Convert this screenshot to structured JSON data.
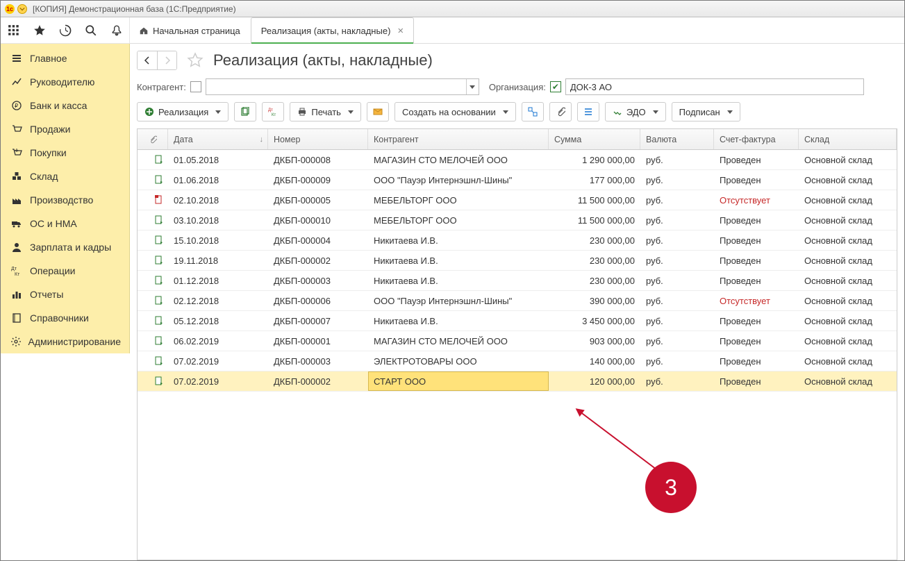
{
  "window_title": "[КОПИЯ] Демонстрационная база  (1С:Предприятие)",
  "tabs": {
    "home": "Начальная страница",
    "active": "Реализация (акты, накладные)"
  },
  "page_title": "Реализация (акты, накладные)",
  "filters": {
    "contr_label": "Контрагент:",
    "org_label": "Организация:",
    "org_value": "ДОК-3 АО"
  },
  "toolbar": {
    "realize": "Реализация",
    "print": "Печать",
    "create_based": "Создать на основании",
    "edo": "ЭДО",
    "signed": "Подписан"
  },
  "columns": {
    "date": "Дата",
    "number": "Номер",
    "contr": "Контрагент",
    "sum": "Сумма",
    "cur": "Валюта",
    "invoice": "Счет-фактура",
    "wh": "Склад"
  },
  "rows": [
    {
      "date": "01.05.2018",
      "num": "ДКБП-000008",
      "contr": "МАГАЗИН СТО МЕЛОЧЕЙ ООО",
      "sum": "1 290 000,00",
      "cur": "руб.",
      "inv": "Проведен",
      "wh": "Основной склад",
      "inv_red": false,
      "icon_red": false
    },
    {
      "date": "01.06.2018",
      "num": "ДКБП-000009",
      "contr": "ООО \"Пауэр Интернэшнл-Шины\"",
      "sum": "177 000,00",
      "cur": "руб.",
      "inv": "Проведен",
      "wh": "Основной склад",
      "inv_red": false,
      "icon_red": false
    },
    {
      "date": "02.10.2018",
      "num": "ДКБП-000005",
      "contr": "МЕБЕЛЬТОРГ ООО",
      "sum": "11 500 000,00",
      "cur": "руб.",
      "inv": "Отсутствует",
      "wh": "Основной склад",
      "inv_red": true,
      "icon_red": true
    },
    {
      "date": "03.10.2018",
      "num": "ДКБП-000010",
      "contr": "МЕБЕЛЬТОРГ ООО",
      "sum": "11 500 000,00",
      "cur": "руб.",
      "inv": "Проведен",
      "wh": "Основной склад",
      "inv_red": false,
      "icon_red": false
    },
    {
      "date": "15.10.2018",
      "num": "ДКБП-000004",
      "contr": "Никитаева И.В.",
      "sum": "230 000,00",
      "cur": "руб.",
      "inv": "Проведен",
      "wh": "Основной склад",
      "inv_red": false,
      "icon_red": false
    },
    {
      "date": "19.11.2018",
      "num": "ДКБП-000002",
      "contr": "Никитаева И.В.",
      "sum": "230 000,00",
      "cur": "руб.",
      "inv": "Проведен",
      "wh": "Основной склад",
      "inv_red": false,
      "icon_red": false
    },
    {
      "date": "01.12.2018",
      "num": "ДКБП-000003",
      "contr": "Никитаева И.В.",
      "sum": "230 000,00",
      "cur": "руб.",
      "inv": "Проведен",
      "wh": "Основной склад",
      "inv_red": false,
      "icon_red": false
    },
    {
      "date": "02.12.2018",
      "num": "ДКБП-000006",
      "contr": "ООО \"Пауэр Интернэшнл-Шины\"",
      "sum": "390 000,00",
      "cur": "руб.",
      "inv": "Отсутствует",
      "wh": "Основной склад",
      "inv_red": true,
      "icon_red": false
    },
    {
      "date": "05.12.2018",
      "num": "ДКБП-000007",
      "contr": "Никитаева И.В.",
      "sum": "3 450 000,00",
      "cur": "руб.",
      "inv": "Проведен",
      "wh": "Основной склад",
      "inv_red": false,
      "icon_red": false
    },
    {
      "date": "06.02.2019",
      "num": "ДКБП-000001",
      "contr": "МАГАЗИН СТО МЕЛОЧЕЙ ООО",
      "sum": "903 000,00",
      "cur": "руб.",
      "inv": "Проведен",
      "wh": "Основной склад",
      "inv_red": false,
      "icon_red": false
    },
    {
      "date": "07.02.2019",
      "num": "ДКБП-000003",
      "contr": "ЭЛЕКТРОТОВАРЫ ООО",
      "sum": "140 000,00",
      "cur": "руб.",
      "inv": "Проведен",
      "wh": "Основной склад",
      "inv_red": false,
      "icon_red": false
    },
    {
      "date": "07.02.2019",
      "num": "ДКБП-000002",
      "contr": "СТАРТ ООО",
      "sum": "120 000,00",
      "cur": "руб.",
      "inv": "Проведен",
      "wh": "Основной склад",
      "inv_red": false,
      "icon_red": false,
      "selected": true
    }
  ],
  "sidebar": [
    {
      "label": "Главное",
      "icon": "hamburger"
    },
    {
      "label": "Руководителю",
      "icon": "chart-up"
    },
    {
      "label": "Банк и касса",
      "icon": "ruble"
    },
    {
      "label": "Продажи",
      "icon": "cart"
    },
    {
      "label": "Покупки",
      "icon": "cart-in"
    },
    {
      "label": "Склад",
      "icon": "boxes"
    },
    {
      "label": "Производство",
      "icon": "factory"
    },
    {
      "label": "ОС и НМА",
      "icon": "truck"
    },
    {
      "label": "Зарплата и кадры",
      "icon": "person"
    },
    {
      "label": "Операции",
      "icon": "dtkt"
    },
    {
      "label": "Отчеты",
      "icon": "bars"
    },
    {
      "label": "Справочники",
      "icon": "book"
    },
    {
      "label": "Администрирование",
      "icon": "gear"
    }
  ],
  "callout": "3"
}
